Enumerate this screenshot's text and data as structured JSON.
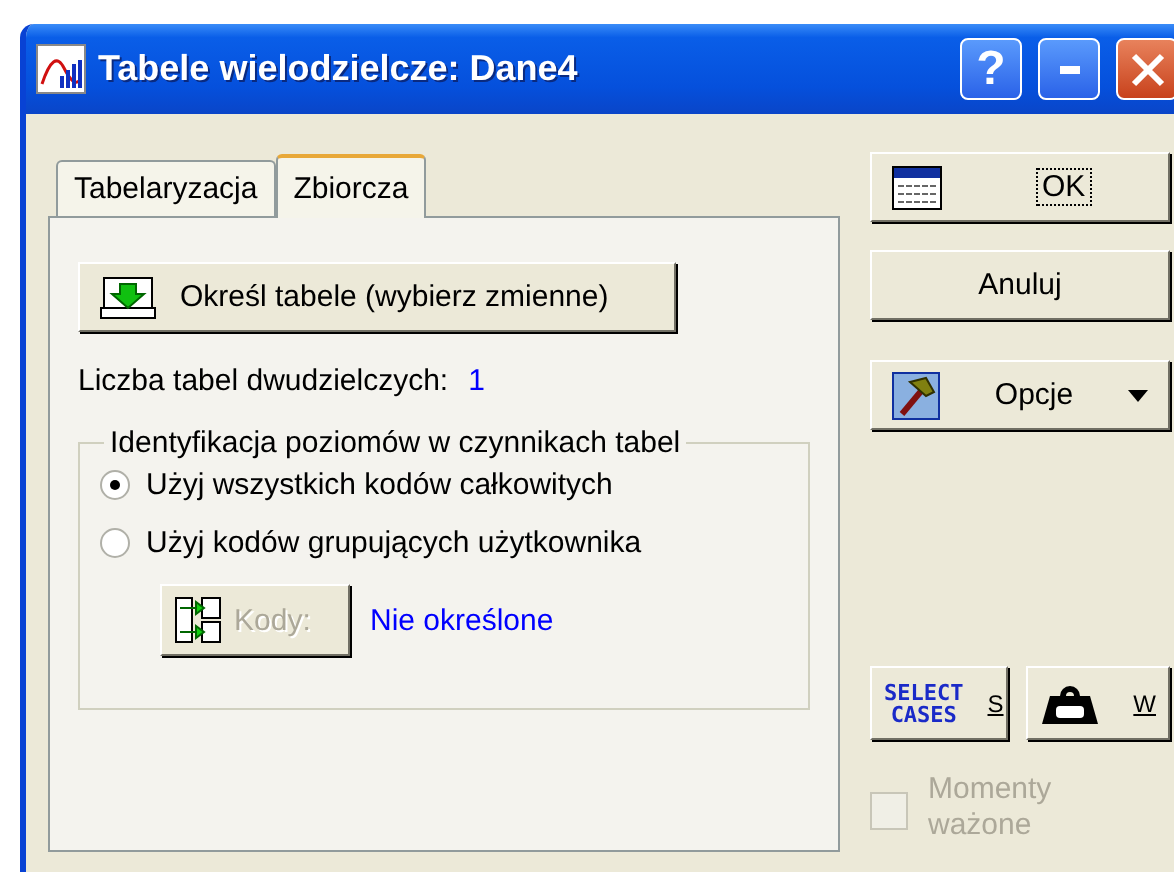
{
  "window": {
    "title": "Tabele wielodzielcze: Dane4",
    "help_button": "?"
  },
  "tabs": [
    {
      "label": "Tabelaryzacja",
      "selected": false
    },
    {
      "label": "Zbiorcza",
      "selected": true
    }
  ],
  "define_button": {
    "label": "Określ tabele (wybierz zmienne)"
  },
  "table_count": {
    "label": "Liczba tabel dwudzielczych:",
    "value": "1"
  },
  "level_group": {
    "title": "Identyfikacja poziomów w czynnikach tabel",
    "options": [
      {
        "label": "Użyj wszystkich kodów całkowitych",
        "selected": true
      },
      {
        "label": "Użyj kodów grupujących użytkownika",
        "selected": false
      }
    ],
    "codes_button": {
      "label": "Kody:",
      "disabled": true
    },
    "codes_status": "Nie określone"
  },
  "actions": {
    "ok": "OK",
    "cancel": "Anuluj",
    "options": "Opcje"
  },
  "select_cases": {
    "lines": [
      "SELECT",
      "CASES"
    ],
    "key": "S"
  },
  "weight_button": {
    "key": "W"
  },
  "weighted_moments": {
    "label": "Momenty ważone",
    "checked": false,
    "disabled": true
  }
}
